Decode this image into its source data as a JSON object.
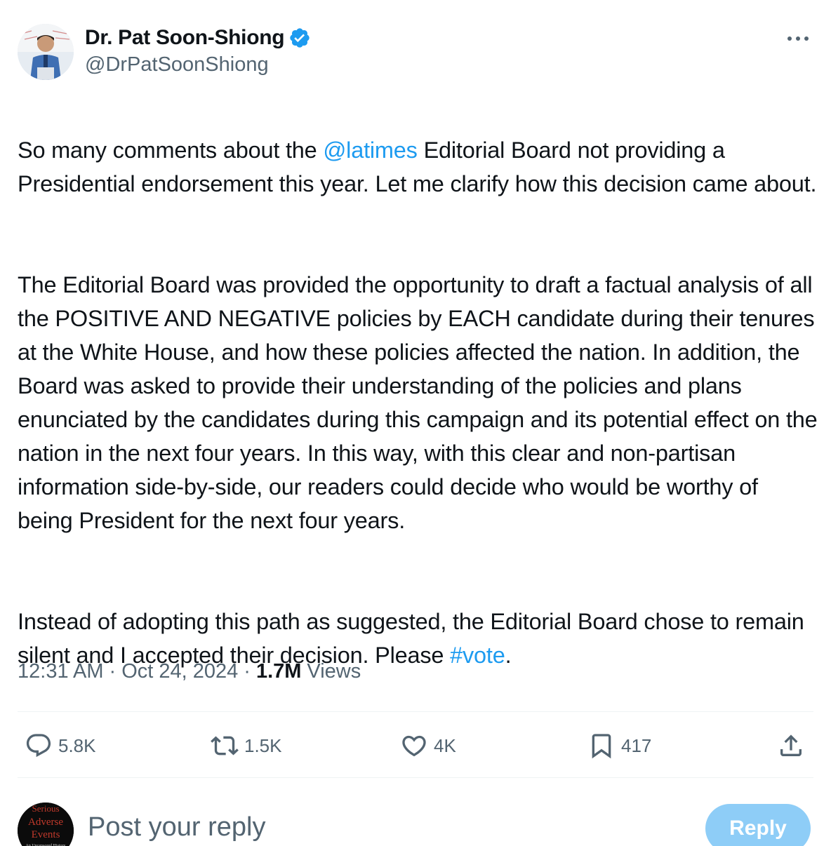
{
  "author": {
    "display_name": "Dr. Pat Soon-Shiong",
    "handle": "@DrPatSoonShiong",
    "verified": true
  },
  "tweet": {
    "p1_before": "So many comments about the ",
    "p1_mention": "@latimes",
    "p1_after": " Editorial Board not providing a Presidential endorsement this year. Let me clarify how this decision came about.",
    "p2": "The Editorial Board was provided the opportunity to draft a factual analysis of all the POSITIVE AND NEGATIVE policies by EACH candidate during their tenures at the White House, and how these policies affected the nation. In addition, the Board was asked to provide their understanding of the policies and plans enunciated by the candidates during this campaign and its potential effect on the nation in the next four years. In this way, with this clear and non-partisan information side-by-side, our readers could decide who would be worthy of being President for the next four years.",
    "p3_before": "Instead of adopting this path as suggested, the Editorial Board chose to remain silent and I accepted their decision. Please ",
    "p3_hashtag": "#vote",
    "p3_after": "."
  },
  "meta": {
    "time": "12:31 AM",
    "date": "Oct 24, 2024",
    "views_count": "1.7M",
    "views_label": "Views"
  },
  "actions": {
    "replies": "5.8K",
    "reposts": "1.5K",
    "likes": "4K",
    "bookmarks": "417"
  },
  "reply_box": {
    "placeholder": "Post your reply",
    "button_label": "Reply",
    "avatar_text": [
      "Serious",
      "Adverse",
      "Events",
      "An Uncensored History"
    ]
  },
  "colors": {
    "link": "#1d9bf0",
    "muted": "#536471",
    "text": "#0f1419",
    "reply_button_disabled": "#8ecdf7"
  },
  "icons": [
    "verified-badge-icon",
    "more-icon",
    "reply-icon",
    "repost-icon",
    "like-icon",
    "bookmark-icon",
    "share-icon"
  ]
}
